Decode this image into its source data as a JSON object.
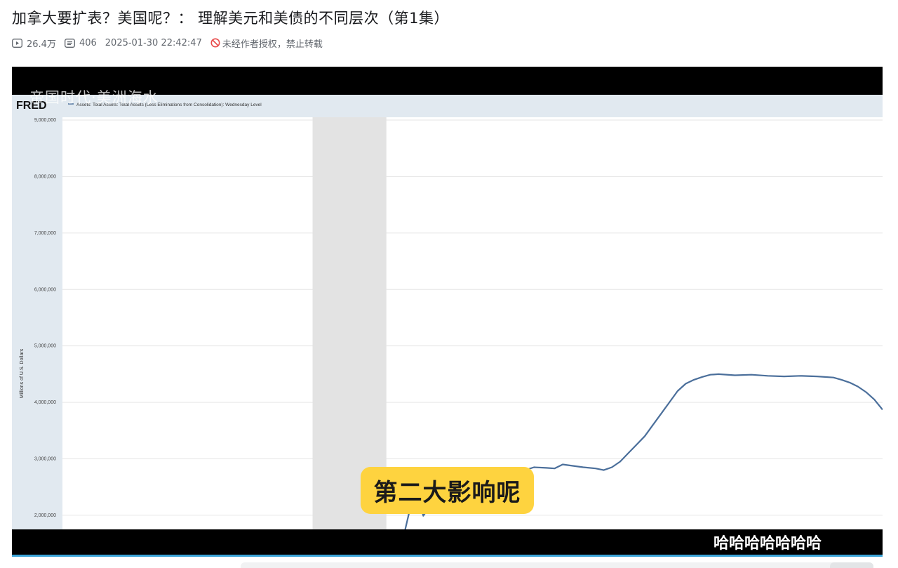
{
  "video": {
    "title": "加拿大要扩表？美国呢？： 理解美元和美债的不同层次（第1集）",
    "views": "26.4万",
    "danmaku_count": "406",
    "publish_time": "2025-01-30 22:42:47",
    "copyright_notice": "未经作者授权，禁止转载"
  },
  "player": {
    "subtitle": "第二大影响呢",
    "watermark_text": "帝国时代·美洲海水",
    "danmaku_text": "哈哈哈哈哈哈哈",
    "progress_color": "#3aa4d8",
    "subtitle_bg": "#fed33f"
  },
  "chart_data": {
    "type": "line",
    "source_logo": "FRED",
    "legend": "Assets: Total Assets: Total Assets (Less Eliminations from Consolidation): Wednesday Level",
    "ylabel": "Millions of U.S. Dollars",
    "yticks": [
      "9,000,000",
      "8,000,000",
      "7,000,000",
      "6,000,000",
      "5,000,000",
      "4,000,000",
      "3,000,000",
      "2,000,000"
    ],
    "ylim": [
      1750000,
      9050000
    ],
    "xlim": [
      0,
      100
    ],
    "recession_band_x": [
      30.5,
      39.5
    ],
    "series_color": "#4b6f9b",
    "series": [
      {
        "values": [
          [
            41.8,
            1750000
          ],
          [
            42.2,
            2000000
          ],
          [
            42.6,
            2250000
          ],
          [
            43.0,
            2150000
          ],
          [
            43.5,
            2280000
          ],
          [
            44.0,
            1990000
          ],
          [
            44.5,
            2100000
          ],
          [
            45.0,
            2050000
          ],
          [
            46.0,
            2090000
          ],
          [
            47.0,
            2120000
          ],
          [
            48.5,
            2200000
          ],
          [
            50.0,
            2350000
          ],
          [
            52.0,
            2550000
          ],
          [
            54.0,
            2700000
          ],
          [
            56.0,
            2780000
          ],
          [
            57.5,
            2850000
          ],
          [
            59.0,
            2840000
          ],
          [
            60.0,
            2830000
          ],
          [
            61.0,
            2900000
          ],
          [
            62.0,
            2880000
          ],
          [
            63.5,
            2850000
          ],
          [
            65.0,
            2830000
          ],
          [
            66.0,
            2800000
          ],
          [
            67.0,
            2850000
          ],
          [
            68.0,
            2950000
          ],
          [
            69.0,
            3100000
          ],
          [
            70.0,
            3250000
          ],
          [
            71.0,
            3400000
          ],
          [
            72.0,
            3600000
          ],
          [
            73.0,
            3800000
          ],
          [
            74.0,
            4000000
          ],
          [
            75.0,
            4200000
          ],
          [
            76.0,
            4330000
          ],
          [
            77.0,
            4400000
          ],
          [
            78.0,
            4450000
          ],
          [
            79.0,
            4490000
          ],
          [
            80.0,
            4500000
          ],
          [
            82.0,
            4480000
          ],
          [
            84.0,
            4490000
          ],
          [
            86.0,
            4470000
          ],
          [
            88.0,
            4460000
          ],
          [
            90.0,
            4470000
          ],
          [
            92.0,
            4460000
          ],
          [
            94.0,
            4440000
          ],
          [
            95.0,
            4400000
          ],
          [
            96.0,
            4350000
          ],
          [
            97.0,
            4280000
          ],
          [
            98.0,
            4180000
          ],
          [
            99.0,
            4050000
          ],
          [
            100.0,
            3870000
          ]
        ]
      }
    ]
  }
}
